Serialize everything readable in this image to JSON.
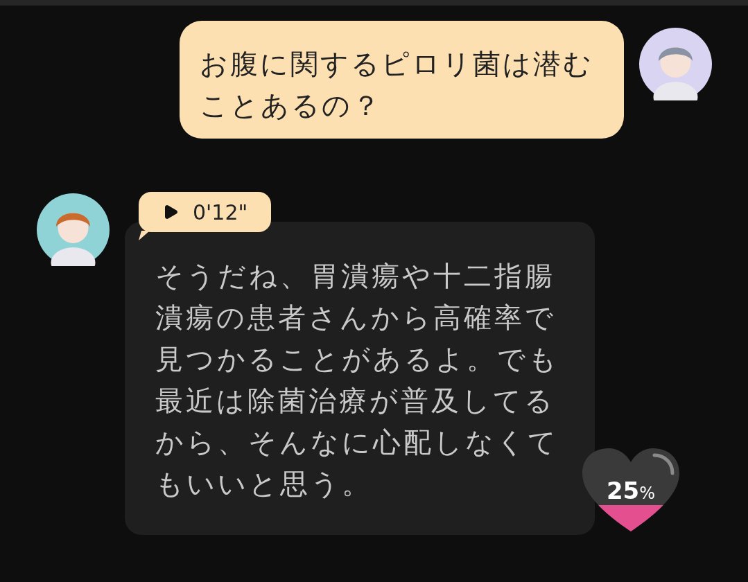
{
  "messages": [
    {
      "kind": "user",
      "text": "お腹に関するピロリ菌は潜むことあるの？"
    },
    {
      "kind": "bot",
      "audio": {
        "duration": "0'12\""
      },
      "text": "そうだね、胃潰瘍や十二指腸潰瘍の患者さんから高確率で見つかることがあるよ。でも最近は除菌治療が普及してるから、そんなに心配しなくてもいいと思う。",
      "affection": {
        "value": "25",
        "unit": "%"
      }
    }
  ]
}
